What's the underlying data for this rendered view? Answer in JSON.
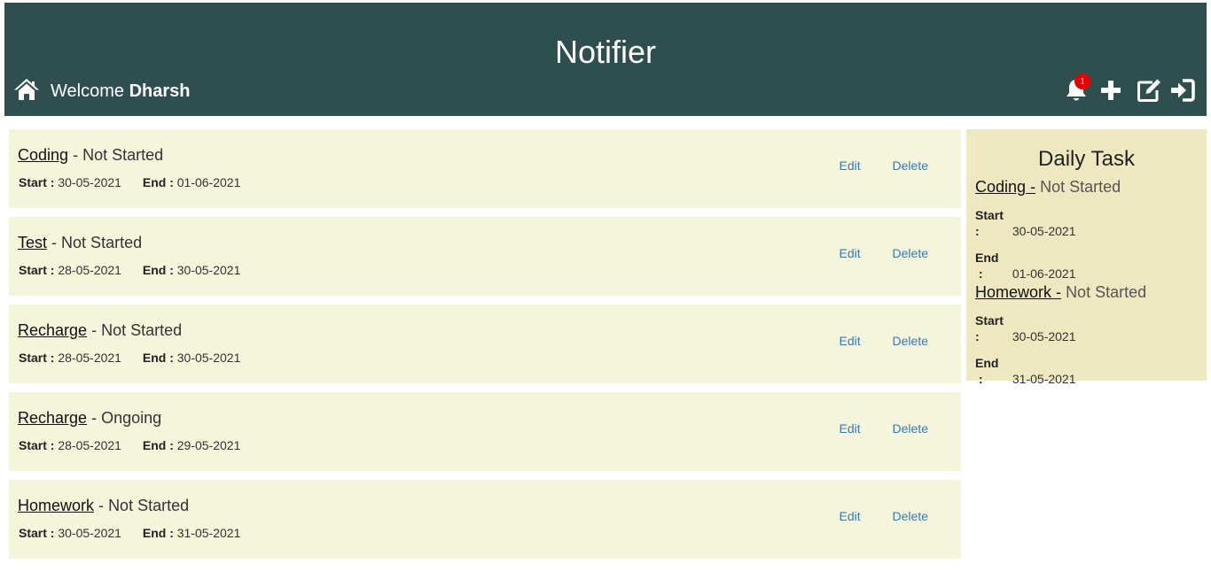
{
  "header": {
    "title": "Notifier",
    "welcome_prefix": "Welcome",
    "username": "Dharsh",
    "notification_count": "1",
    "bg_color": "#2f4f4f"
  },
  "icons": {
    "home": "home-icon",
    "bell": "bell-icon",
    "add": "plus-icon",
    "edit": "edit-icon",
    "logout": "sign-in-icon"
  },
  "labels": {
    "start": "Start :",
    "end": "End :",
    "separator": "-",
    "edit": "Edit",
    "delete": "Delete"
  },
  "tasks": [
    {
      "name": "Coding",
      "status": "Not Started",
      "start": "30-05-2021",
      "end": "01-06-2021"
    },
    {
      "name": "Test",
      "status": "Not Started",
      "start": "28-05-2021",
      "end": "30-05-2021"
    },
    {
      "name": "Recharge",
      "status": "Not Started",
      "start": "28-05-2021",
      "end": "30-05-2021"
    },
    {
      "name": "Recharge",
      "status": "Ongoing",
      "start": "28-05-2021",
      "end": "29-05-2021"
    },
    {
      "name": "Homework",
      "status": "Not Started",
      "start": "30-05-2021",
      "end": "31-05-2021"
    }
  ],
  "daily": {
    "title": "Daily Task",
    "start_label": "Start",
    "end_label": "End",
    "colon": ":",
    "items": [
      {
        "name": "Coding",
        "sep": "-",
        "status": "Not Started",
        "start": "30-05-2021",
        "end": "01-06-2021"
      },
      {
        "name": "Homework",
        "sep": "-",
        "status": "Not Started",
        "start": "30-05-2021",
        "end": "31-05-2021"
      }
    ]
  }
}
